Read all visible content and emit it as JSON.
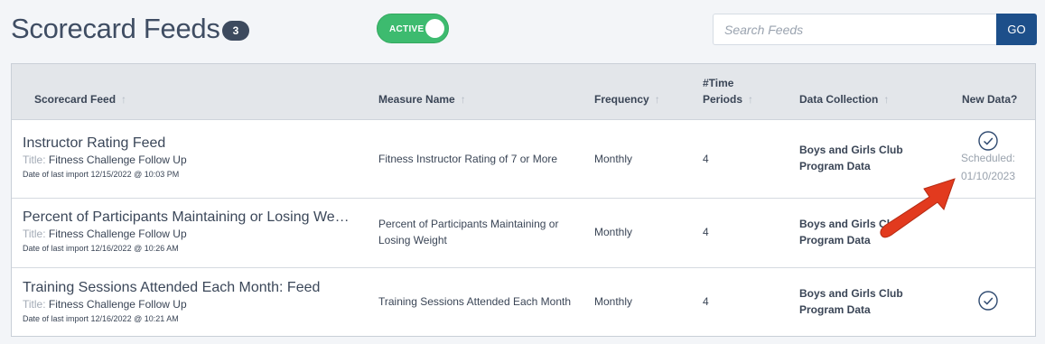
{
  "header": {
    "title": "Scorecard Feeds",
    "count": "3",
    "toggle_label": "ACTIVE",
    "search_placeholder": "Search Feeds",
    "search_button": "GO"
  },
  "table": {
    "columns": [
      {
        "line1": "",
        "line2": "Scorecard Feed",
        "sortable": true
      },
      {
        "line1": "",
        "line2": "Measure Name",
        "sortable": true
      },
      {
        "line1": "",
        "line2": "Frequency",
        "sortable": true
      },
      {
        "line1": "#Time",
        "line2": "Periods",
        "sortable": true
      },
      {
        "line1": "",
        "line2": "Data Collection",
        "sortable": true
      },
      {
        "line1": "",
        "line2": "New Data?",
        "sortable": false
      }
    ],
    "title_prefix": "Title:",
    "rows": [
      {
        "feed": "Instructor Rating Feed",
        "title": "Fitness Challenge Follow Up",
        "last_import": "Date of last import 12/15/2022 @ 10:03 PM",
        "measure": "Fitness Instructor Rating of 7 or More",
        "frequency": "Monthly",
        "periods": "4",
        "collection": "Boys and Girls Club Program Data",
        "new_data": "check",
        "scheduled_label": "Scheduled:",
        "scheduled_date": "01/10/2023"
      },
      {
        "feed": "Percent of Participants Maintaining or Losing Weight",
        "title": "Fitness Challenge Follow Up",
        "last_import": "Date of last import 12/16/2022 @ 10:26 AM",
        "measure": "Percent of Participants Maintaining or Losing Weight",
        "frequency": "Monthly",
        "periods": "4",
        "collection": "Boys and Girls Club Program Data",
        "new_data": ""
      },
      {
        "feed": "Training Sessions Attended Each Month: Feed",
        "title": "Fitness Challenge Follow Up",
        "last_import": "Date of last import 12/16/2022 @ 10:21 AM",
        "measure": "Training Sessions Attended Each Month",
        "frequency": "Monthly",
        "periods": "4",
        "collection": "Boys and Girls Club Program Data",
        "new_data": "check"
      }
    ]
  },
  "colors": {
    "toggle_active": "#3dbb6f",
    "go_button": "#1d4f8a",
    "annotation_arrow": "#e23a1e"
  },
  "icons": [
    "sort-arrow-icon",
    "check-circle-icon",
    "red-arrow-annotation-icon"
  ]
}
